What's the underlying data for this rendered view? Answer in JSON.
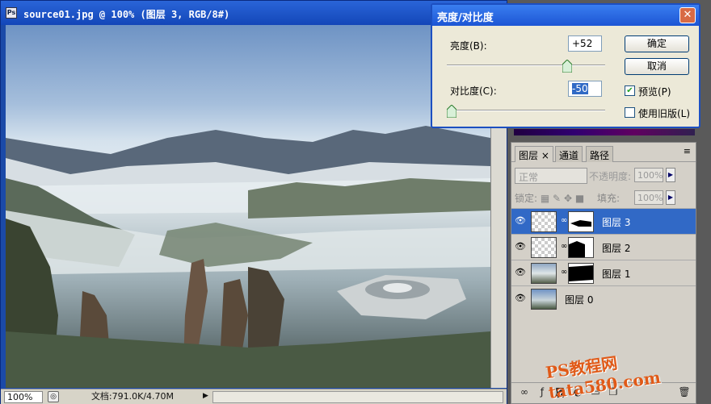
{
  "document": {
    "title": "source01.jpg @ 100% (图层 3, RGB/8#)",
    "app_icon": "Ps",
    "zoom": "100%",
    "doc_info": "文档:791.0K/4.70M"
  },
  "dialog": {
    "title": "亮度/对比度",
    "brightness_label": "亮度(B):",
    "brightness_value": "+52",
    "brightness_level": 0.76,
    "contrast_label": "对比度(C):",
    "contrast_value": "-50",
    "contrast_level": 0.0,
    "ok_label": "确定",
    "cancel_label": "取消",
    "preview_label": "预览(P)",
    "preview_checked": true,
    "legacy_label": "使用旧版(L)",
    "legacy_checked": false
  },
  "layers_panel": {
    "tabs": [
      "图层",
      "通道",
      "路径"
    ],
    "blend_mode": "正常",
    "opacity_label": "不透明度:",
    "opacity_value": "100%",
    "lock_label": "锁定:",
    "fill_label": "填充:",
    "fill_value": "100%",
    "layers": [
      {
        "name": "图层 3",
        "selected": true,
        "has_mask": true
      },
      {
        "name": "图层 2",
        "selected": false,
        "has_mask": true
      },
      {
        "name": "图层 1",
        "selected": false,
        "has_mask": true
      },
      {
        "name": "图层 0",
        "selected": false,
        "has_mask": false
      }
    ]
  },
  "watermark": "PS教程网 tata580.com",
  "colors": {
    "titlebar": "#1346b8",
    "selected_layer": "#3169c6",
    "watermark": "#e05a18"
  }
}
